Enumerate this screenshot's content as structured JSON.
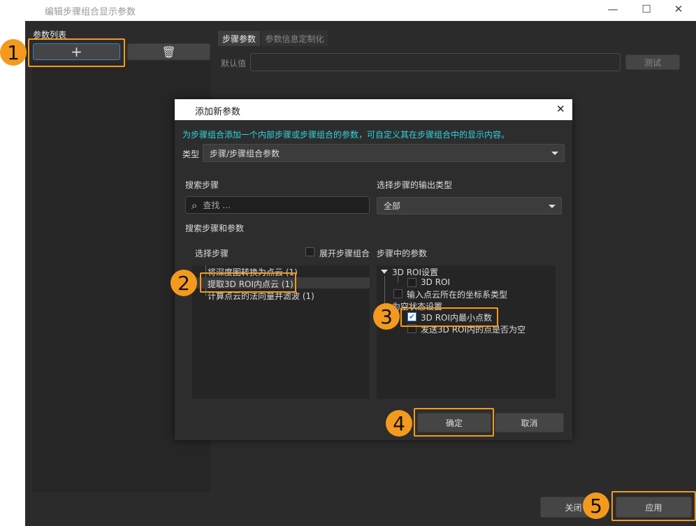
{
  "window": {
    "title": "编辑步骤组合显示参数",
    "controls": [
      "minimize",
      "maximize",
      "close"
    ]
  },
  "left_panel": {
    "label": "参数列表",
    "add_icon": "plus-icon",
    "delete_icon": "trash-icon"
  },
  "tabs": [
    {
      "label": "步骤参数",
      "active": true
    },
    {
      "label": "参数信息定制化",
      "active": false
    }
  ],
  "default_value": {
    "label": "默认值",
    "value": "",
    "test_label": "测试"
  },
  "dialog": {
    "title": "添加新参数",
    "info": "为步骤组合添加一个内部步骤或步骤组合的参数，可自定义其在步骤组合中的显示内容。",
    "type_label": "类型",
    "type_value": "步骤/步骤组合参数",
    "search_steps_label": "搜索步骤",
    "search_placeholder": "查找 ...",
    "output_type_label": "选择步骤的输出类型",
    "output_type_value": "全部",
    "search_steps_params_label": "搜索步骤和参数",
    "select_step_label": "选择步骤",
    "expand_label": "展开步骤组合",
    "params_label": "步骤中的参数",
    "steps": [
      {
        "label": "将深度图转换为点云 (1)",
        "selected": false
      },
      {
        "label": "提取3D ROI内点云 (1)",
        "selected": true
      },
      {
        "label": "计算点云的法向量并滤波 (1)",
        "selected": false
      }
    ],
    "params": {
      "group1": "3D ROI设置",
      "g1_items": [
        {
          "label": "3D ROI",
          "checked": false
        }
      ],
      "item2": {
        "label": "输入点云所在的坐标系类型",
        "checked": false
      },
      "group2": "为空状态设置",
      "g2_items": [
        {
          "label": "3D ROI内最小点数",
          "checked": true
        },
        {
          "label": "发送3D ROI内的点是否为空",
          "checked": false
        }
      ]
    },
    "ok_label": "确定",
    "cancel_label": "取消"
  },
  "footer": {
    "close_label": "关闭",
    "apply_label": "应用"
  },
  "badges": [
    "1",
    "2",
    "3",
    "4",
    "5"
  ],
  "colors": {
    "accent": "#f39a1e",
    "info_text": "#2fd3e0",
    "check": "#2a7fd8"
  }
}
